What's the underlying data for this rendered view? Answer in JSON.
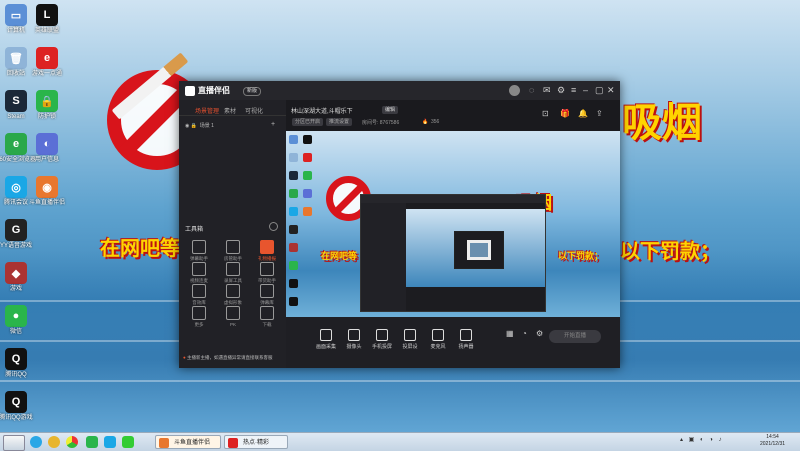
{
  "desktop": {
    "icons": [
      {
        "label": "计算机",
        "color": "#5b8fd6",
        "glyph": "▭"
      },
      {
        "label": "回收站",
        "color": "#8fb4d8",
        "glyph": "🗑"
      },
      {
        "label": "Steam",
        "color": "#1b2838",
        "glyph": "S"
      },
      {
        "label": "360安全浏览器",
        "color": "#2aa84a",
        "glyph": "e"
      },
      {
        "label": "腾讯会议",
        "color": "#1aa7e6",
        "glyph": "◎"
      },
      {
        "label": "YY语音游戏",
        "color": "#222",
        "glyph": "G"
      },
      {
        "label": "游戏",
        "color": "#a33",
        "glyph": "◆"
      },
      {
        "label": "微信",
        "color": "#2ab54b",
        "glyph": "●"
      },
      {
        "label": "腾讯QQ",
        "color": "#111",
        "glyph": "Q"
      },
      {
        "label": "腾讯QQ游戏",
        "color": "#111",
        "glyph": "Q"
      }
    ],
    "icons_col2": [
      {
        "label": "英雄联盟",
        "color": "#111",
        "glyph": "L"
      },
      {
        "label": "游戏一点通",
        "color": "#d22",
        "glyph": "e"
      },
      {
        "label": "防护锁",
        "color": "#2ab54b",
        "glyph": "🔒"
      },
      {
        "label": "用户信息",
        "color": "#5b6fd6",
        "glyph": "◐"
      },
      {
        "label": "斗鱼直播伴侣",
        "color": "#e8772e",
        "glyph": "◉"
      }
    ],
    "banner_text_left": "在网吧等",
    "banner_text_right": "以下罚款；",
    "banner_title_right": "吸烟"
  },
  "app": {
    "name": "直播伴侣",
    "version": "新版",
    "sidebar_tabs": [
      "场景管理",
      "素材",
      "可视化"
    ],
    "scene_item": "场景 1",
    "tools_title": "工具箱",
    "tools": [
      {
        "label": "弹幕助手",
        "hot": false
      },
      {
        "label": "房管助手",
        "hot": false
      },
      {
        "label": "礼物播报",
        "hot": true
      },
      {
        "label": "视频连麦",
        "hot": false
      },
      {
        "label": "录屏工具",
        "hot": false
      },
      {
        "label": "带货助手",
        "hot": false
      },
      {
        "label": "音效库",
        "hot": false
      },
      {
        "label": "虚拟形象",
        "hot": false
      },
      {
        "label": "弹幕库",
        "hot": false
      },
      {
        "label": "更多",
        "hot": false
      },
      {
        "label": "PK",
        "hot": false
      },
      {
        "label": "下载",
        "hot": false
      }
    ],
    "preview_title": "林山深湖大道,斗帽乐下",
    "preview_edit": "编辑",
    "preview_badges": [
      "分区已开启",
      "推流设置"
    ],
    "room_info": "房间号: 8767586",
    "hot_count": "356",
    "bottom_actions": [
      "画面采集",
      "摄像头",
      "手机投屏",
      "投屏设",
      "麦克风",
      "扬声器"
    ],
    "start_live": "开始直播",
    "notice": "主播新主播，如遇直播异常请直接联系客服"
  },
  "taskbar": {
    "items": [
      "斗鱼直播伴侣",
      "热点·精彩"
    ],
    "clock_time": "14:54",
    "clock_date": "2021/12/31"
  }
}
